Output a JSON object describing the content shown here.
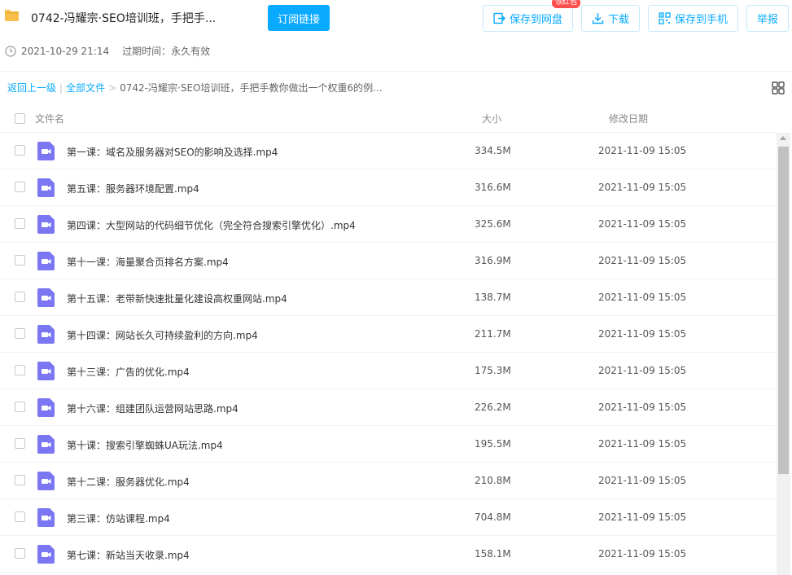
{
  "header": {
    "title": "0742-冯耀宗·SEO培训班，手把手...",
    "subscribe_label": "订阅链接",
    "save_to_disk_label": "保存到网盘",
    "red_badge": "领红包",
    "download_label": "下载",
    "save_to_phone_label": "保存到手机",
    "report_label": "举报"
  },
  "meta": {
    "created": "2021-10-29 21:14",
    "expire": "过期时间：永久有效"
  },
  "breadcrumb": {
    "back": "返回上一级",
    "all": "全部文件",
    "current": "0742-冯耀宗·SEO培训班，手把手教你做出一个权重6的例..."
  },
  "table": {
    "col_name": "文件名",
    "col_size": "大小",
    "col_date": "修改日期",
    "rows": [
      {
        "name": "第一课：域名及服务器对SEO的影响及选择.mp4",
        "size": "334.5M",
        "date": "2021-11-09 15:05"
      },
      {
        "name": "第五课：服务器环境配置.mp4",
        "size": "316.6M",
        "date": "2021-11-09 15:05"
      },
      {
        "name": "第四课：大型网站的代码细节优化（完全符合搜索引擎优化）.mp4",
        "size": "325.6M",
        "date": "2021-11-09 15:05"
      },
      {
        "name": "第十一课：海量聚合页排名方案.mp4",
        "size": "316.9M",
        "date": "2021-11-09 15:05"
      },
      {
        "name": "第十五课：老带新快速批量化建设高权重网站.mp4",
        "size": "138.7M",
        "date": "2021-11-09 15:05"
      },
      {
        "name": "第十四课：网站长久可持续盈利的方向.mp4",
        "size": "211.7M",
        "date": "2021-11-09 15:05"
      },
      {
        "name": "第十三课：广告的优化.mp4",
        "size": "175.3M",
        "date": "2021-11-09 15:05"
      },
      {
        "name": "第十六课：组建团队运营网站思路.mp4",
        "size": "226.2M",
        "date": "2021-11-09 15:05"
      },
      {
        "name": "第十课：搜索引擎蜘蛛UA玩法.mp4",
        "size": "195.5M",
        "date": "2021-11-09 15:05"
      },
      {
        "name": "第十二课：服务器优化.mp4",
        "size": "210.8M",
        "date": "2021-11-09 15:05"
      },
      {
        "name": "第三课：仿站课程.mp4",
        "size": "704.8M",
        "date": "2021-11-09 15:05"
      },
      {
        "name": "第七课：新站当天收录.mp4",
        "size": "158.1M",
        "date": "2021-11-09 15:05"
      }
    ]
  },
  "colors": {
    "accent": "#09aaff",
    "badge": "#ff4f4f",
    "video_icon": "#7b77f2",
    "folder": "#f7c04a"
  },
  "icons": {
    "folder": "folder-icon",
    "save": "save-to-disk-icon",
    "download": "download-icon",
    "phone": "qr-phone-icon",
    "clock": "clock-icon",
    "grid": "grid-view-icon",
    "file": "video-file-icon"
  }
}
